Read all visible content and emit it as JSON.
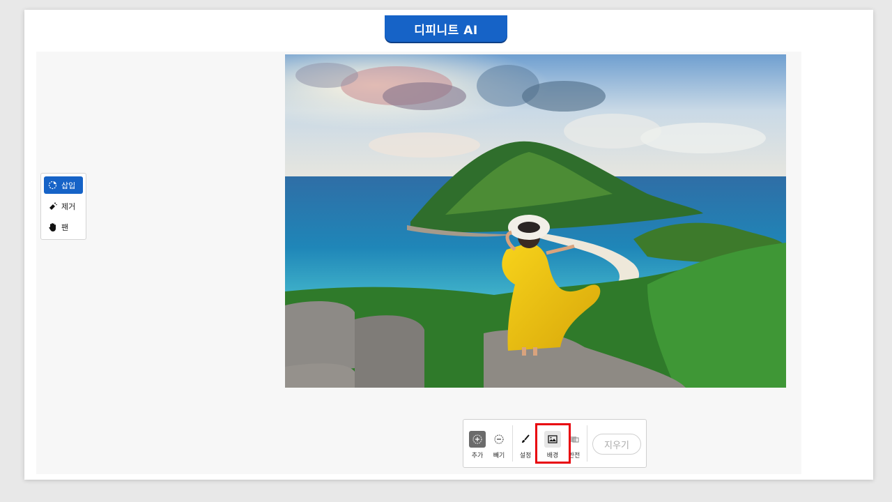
{
  "banner": {
    "title": "디피니트 AI"
  },
  "tools": [
    {
      "label": "삽입",
      "icon": "dashed-circle-icon",
      "active": true
    },
    {
      "label": "제거",
      "icon": "eraser-icon",
      "active": false
    },
    {
      "label": "팬",
      "icon": "hand-icon",
      "active": false
    }
  ],
  "bottombar": {
    "add": "추가",
    "subtract": "빼기",
    "settings": "설정",
    "background": "배경",
    "invert": "반전",
    "clear": "지우기"
  },
  "colors": {
    "brand": "#1663c7",
    "highlight": "#e8000b"
  }
}
